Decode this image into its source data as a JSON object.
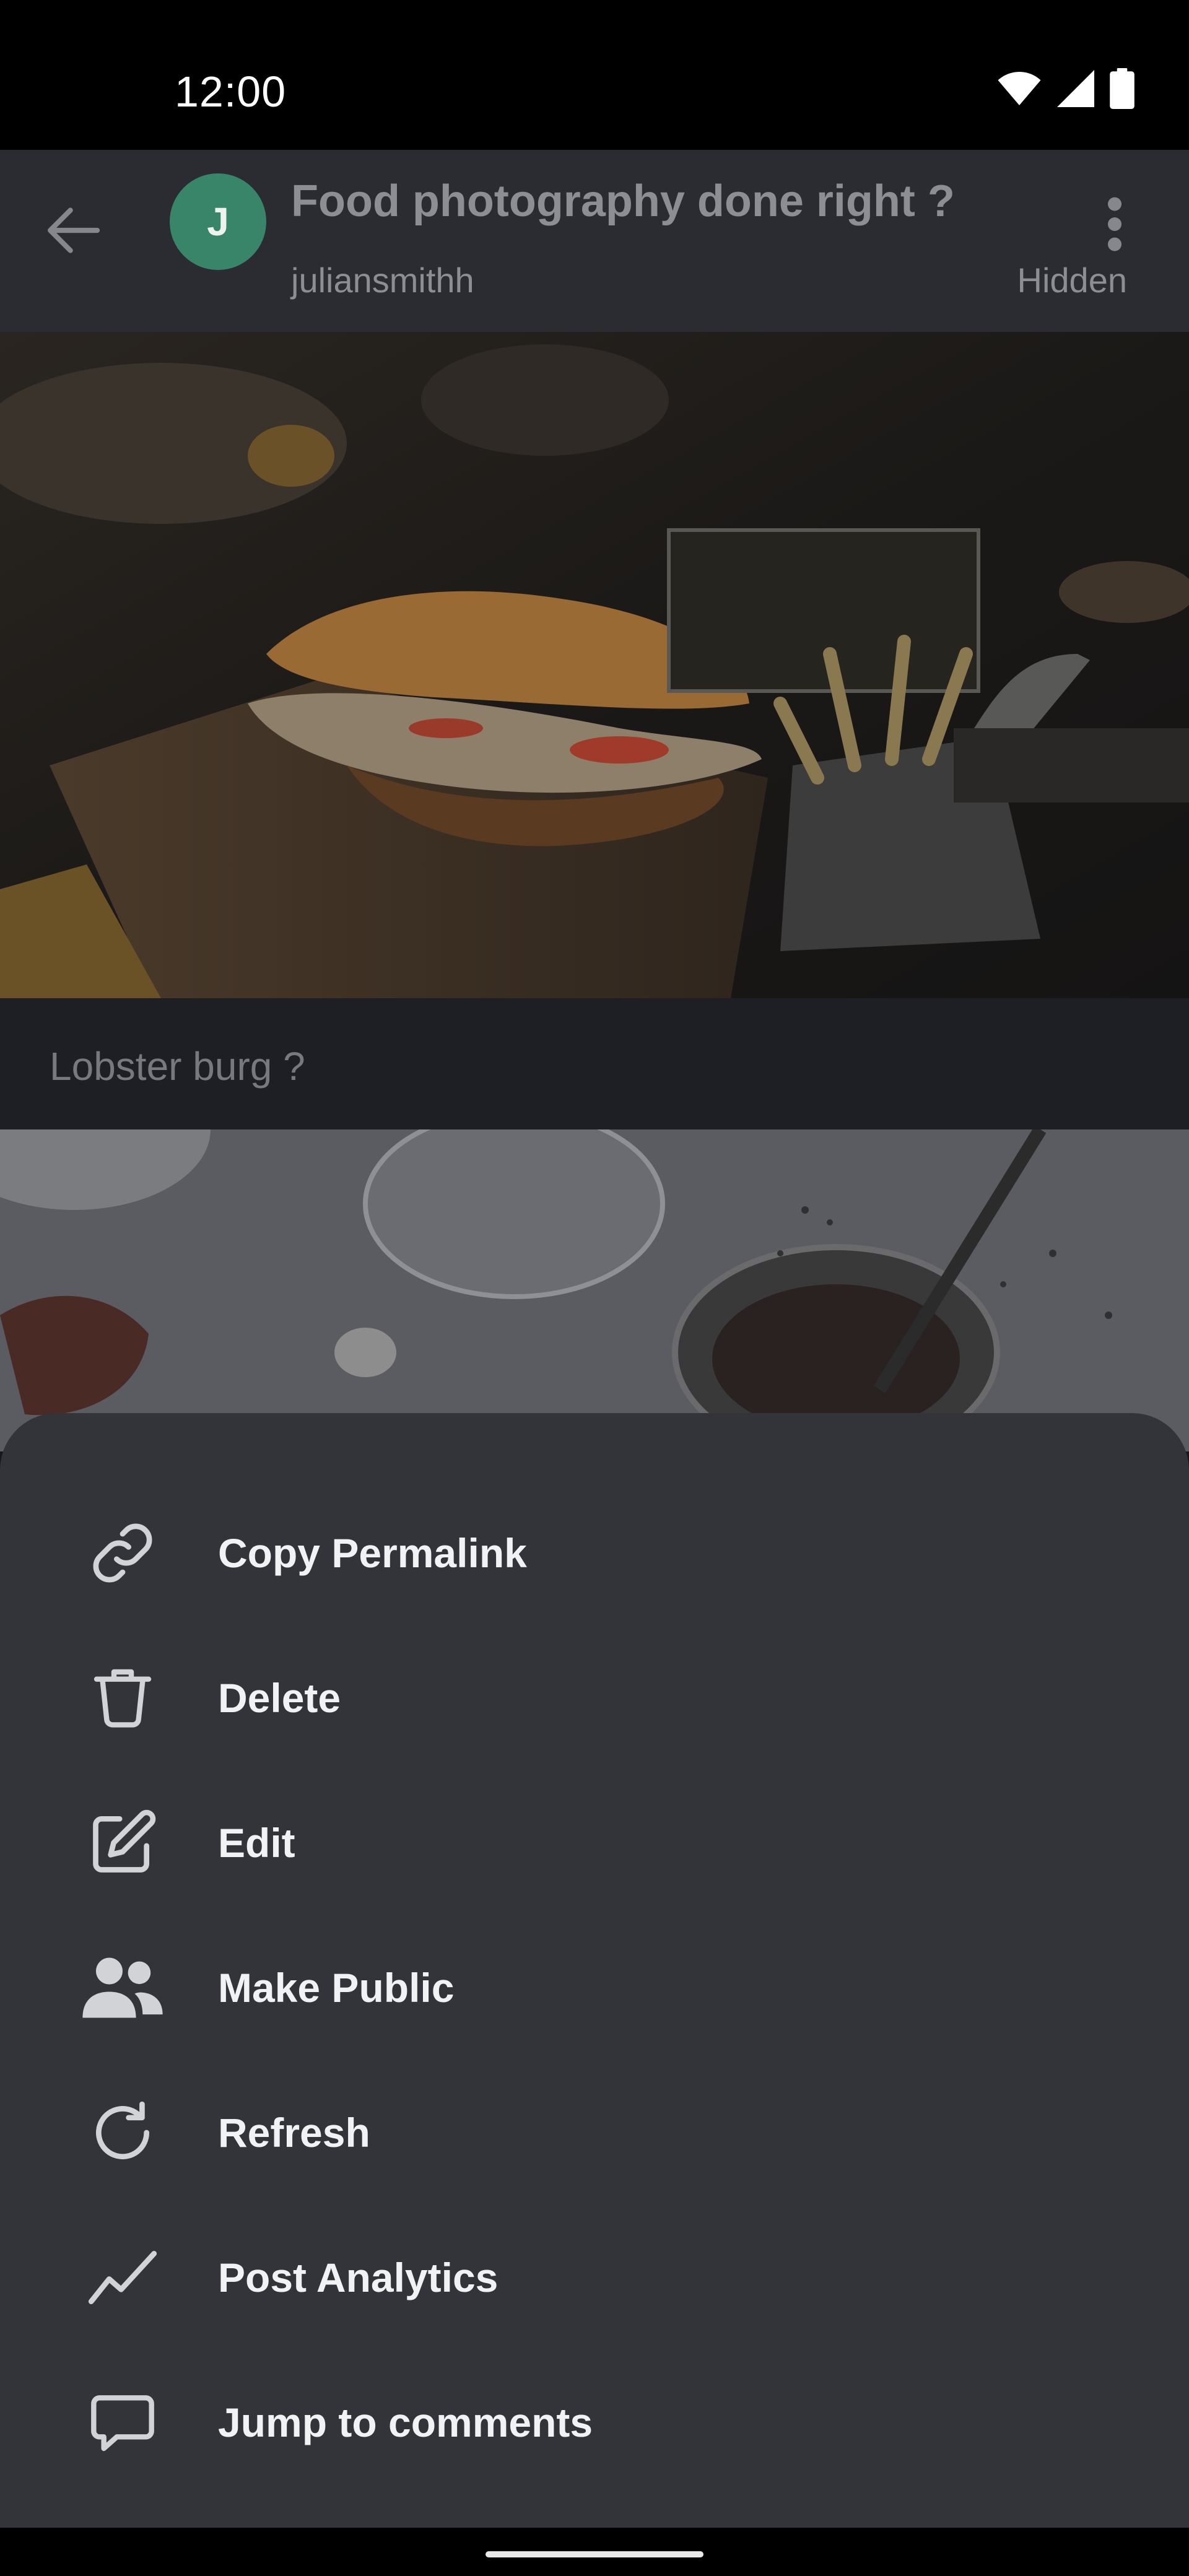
{
  "status_bar": {
    "time": "12:00",
    "icons": [
      "wifi-icon",
      "cell-signal-icon",
      "battery-icon"
    ]
  },
  "app_bar": {
    "back_icon": "arrow-back-icon",
    "avatar_letter": "J",
    "avatar_color": "#38856a",
    "title": "Food photography done right ?",
    "author": "juliansmithh",
    "visibility": "Hidden",
    "overflow_icon": "more-vert-icon"
  },
  "post": {
    "caption": "Lobster burg ?"
  },
  "sheet": {
    "items": [
      {
        "label": "Copy Permalink",
        "icon": "link-icon"
      },
      {
        "label": "Delete",
        "icon": "trash-icon"
      },
      {
        "label": "Edit",
        "icon": "edit-icon"
      },
      {
        "label": "Make Public",
        "icon": "people-icon"
      },
      {
        "label": "Refresh",
        "icon": "refresh-icon"
      },
      {
        "label": "Post Analytics",
        "icon": "analytics-icon"
      },
      {
        "label": "Jump to comments",
        "icon": "comment-icon"
      }
    ]
  },
  "colors": {
    "sheet_background": "#333439",
    "app_bar_background": "#2a2c31",
    "label_text": "#f1f2f4",
    "muted_text": "#8c8e93"
  }
}
